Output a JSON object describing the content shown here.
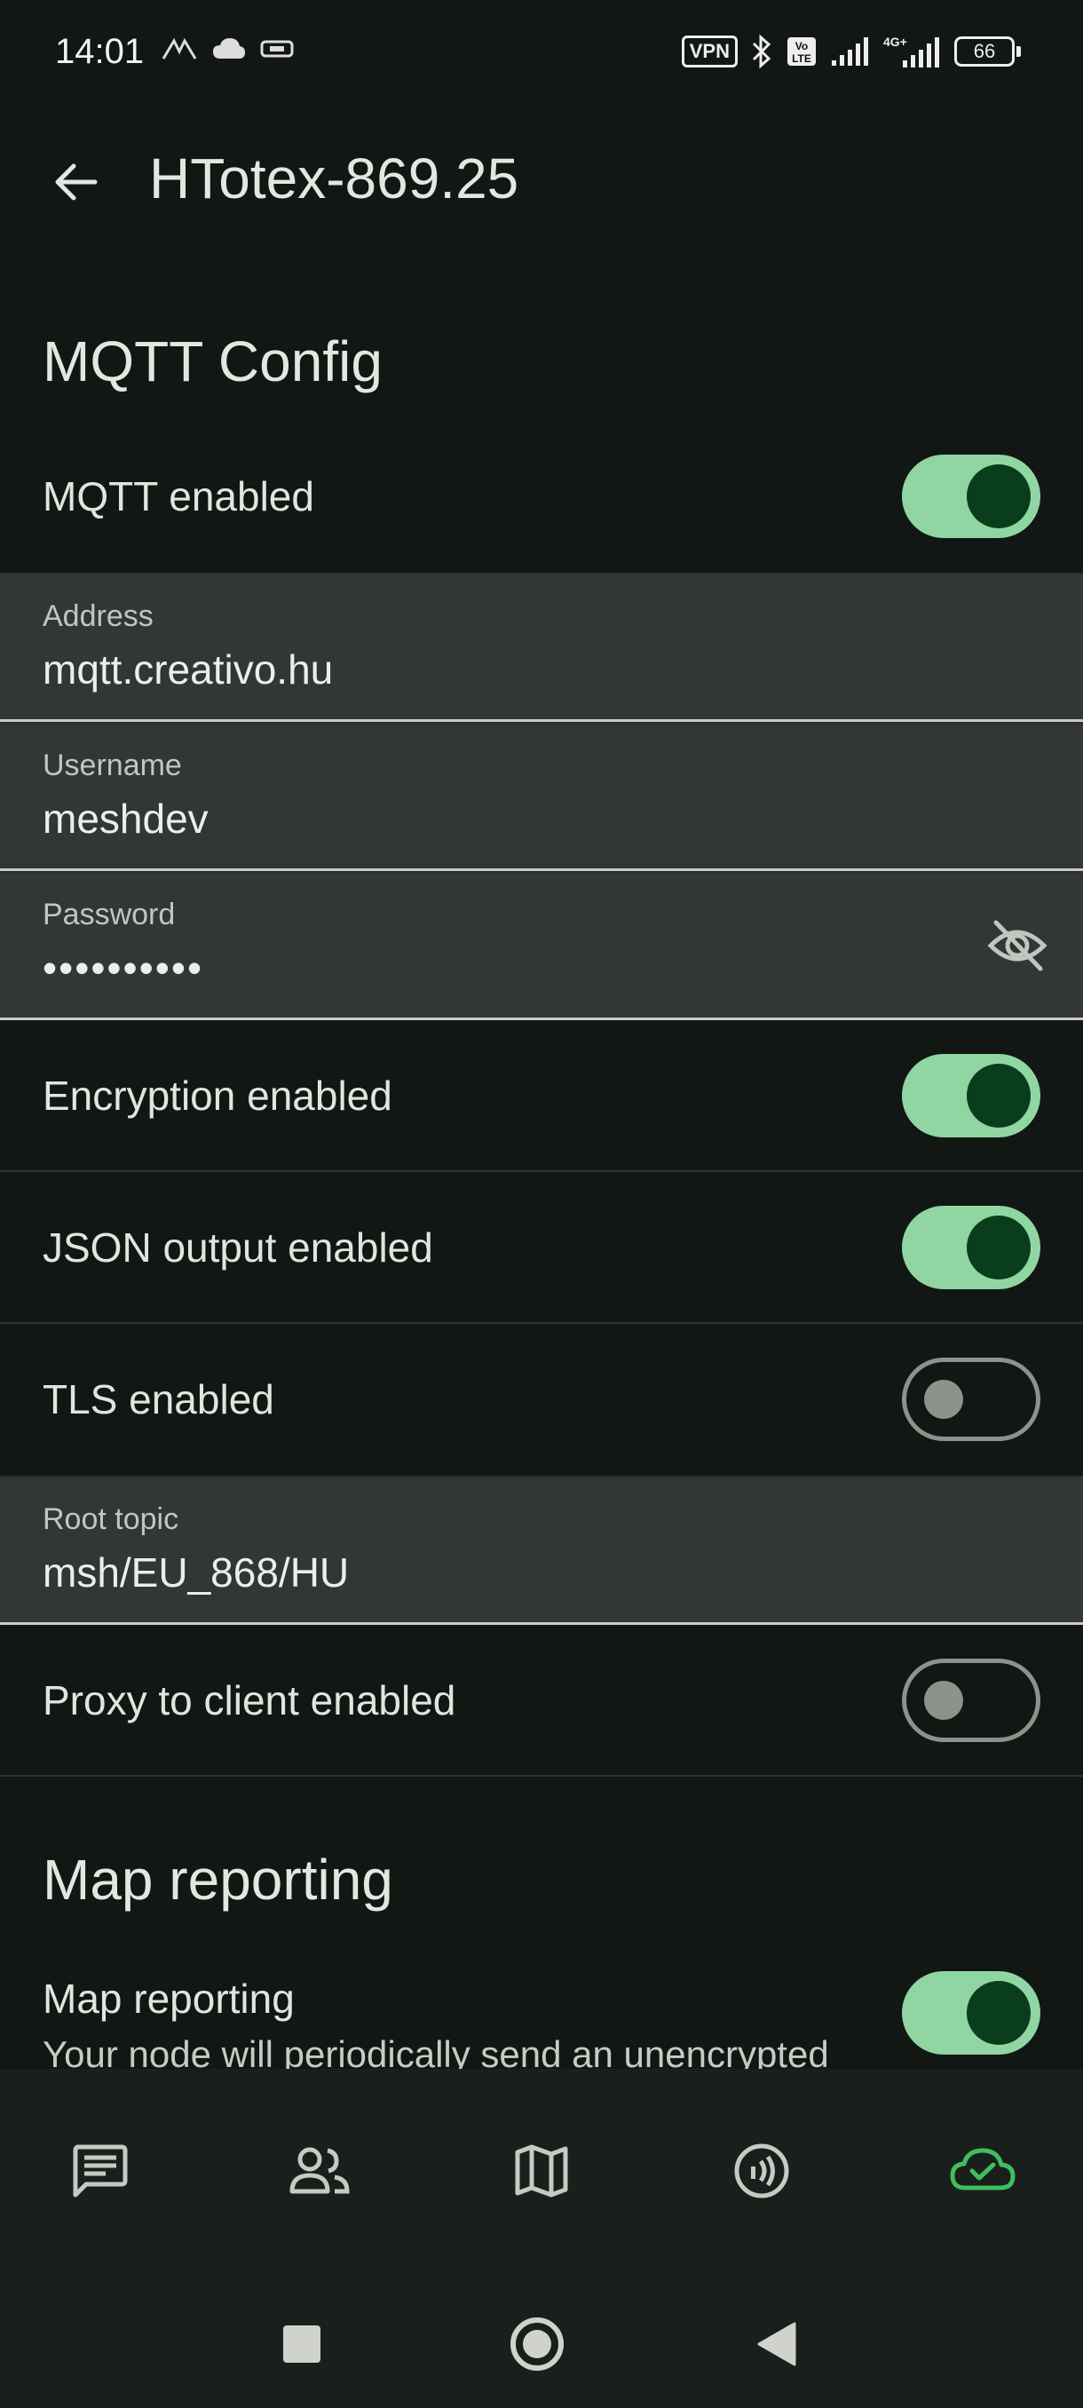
{
  "status_bar": {
    "time": "14:01",
    "vpn": "VPN",
    "battery": "66"
  },
  "app_bar": {
    "title": "HTotex-869.25"
  },
  "mqtt": {
    "section_title": "MQTT Config",
    "mqtt_enabled": {
      "label": "MQTT enabled",
      "on": true
    },
    "address": {
      "label": "Address",
      "value": "mqtt.creativo.hu"
    },
    "username": {
      "label": "Username",
      "value": "meshdev"
    },
    "password": {
      "label": "Password",
      "value": "••••••••••"
    },
    "encryption_enabled": {
      "label": "Encryption enabled",
      "on": true
    },
    "json_output_enabled": {
      "label": "JSON output enabled",
      "on": true
    },
    "tls_enabled": {
      "label": "TLS enabled",
      "on": false
    },
    "root_topic": {
      "label": "Root topic",
      "value": "msh/EU_868/HU"
    },
    "proxy_to_client_enabled": {
      "label": "Proxy to client enabled",
      "on": false
    }
  },
  "map_reporting": {
    "section_title": "Map reporting",
    "toggle": {
      "label": "Map reporting",
      "on": true
    },
    "description": "Your node will periodically send an unencrypted"
  },
  "bottom_nav": {
    "items": [
      "messages-icon",
      "nodes-icon",
      "map-icon",
      "channels-icon",
      "connections-icon"
    ],
    "active_index": 4,
    "active_color": "#3fbf5c",
    "inactive_color": "#c6cac4"
  },
  "colors": {
    "toggle_on_track": "#8fd6a2",
    "toggle_on_knob": "#0a3d1c",
    "background": "#121714"
  }
}
